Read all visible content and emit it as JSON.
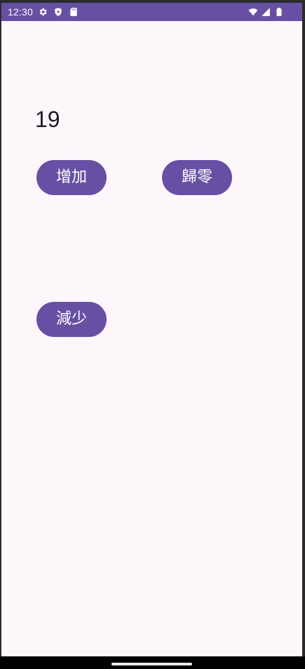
{
  "status_bar": {
    "time": "12:30",
    "left_icons": [
      "gear-icon",
      "shield-play-icon",
      "sd-card-icon"
    ],
    "right_icons": [
      "wifi-icon",
      "cell-signal-icon",
      "battery-icon"
    ]
  },
  "counter": {
    "value": "19"
  },
  "buttons": {
    "increment_label": "增加",
    "reset_label": "歸零",
    "decrement_label": "減少"
  },
  "colors": {
    "accent": "#6750a4",
    "background": "#fdf7fc",
    "text": "#1d1b20"
  }
}
